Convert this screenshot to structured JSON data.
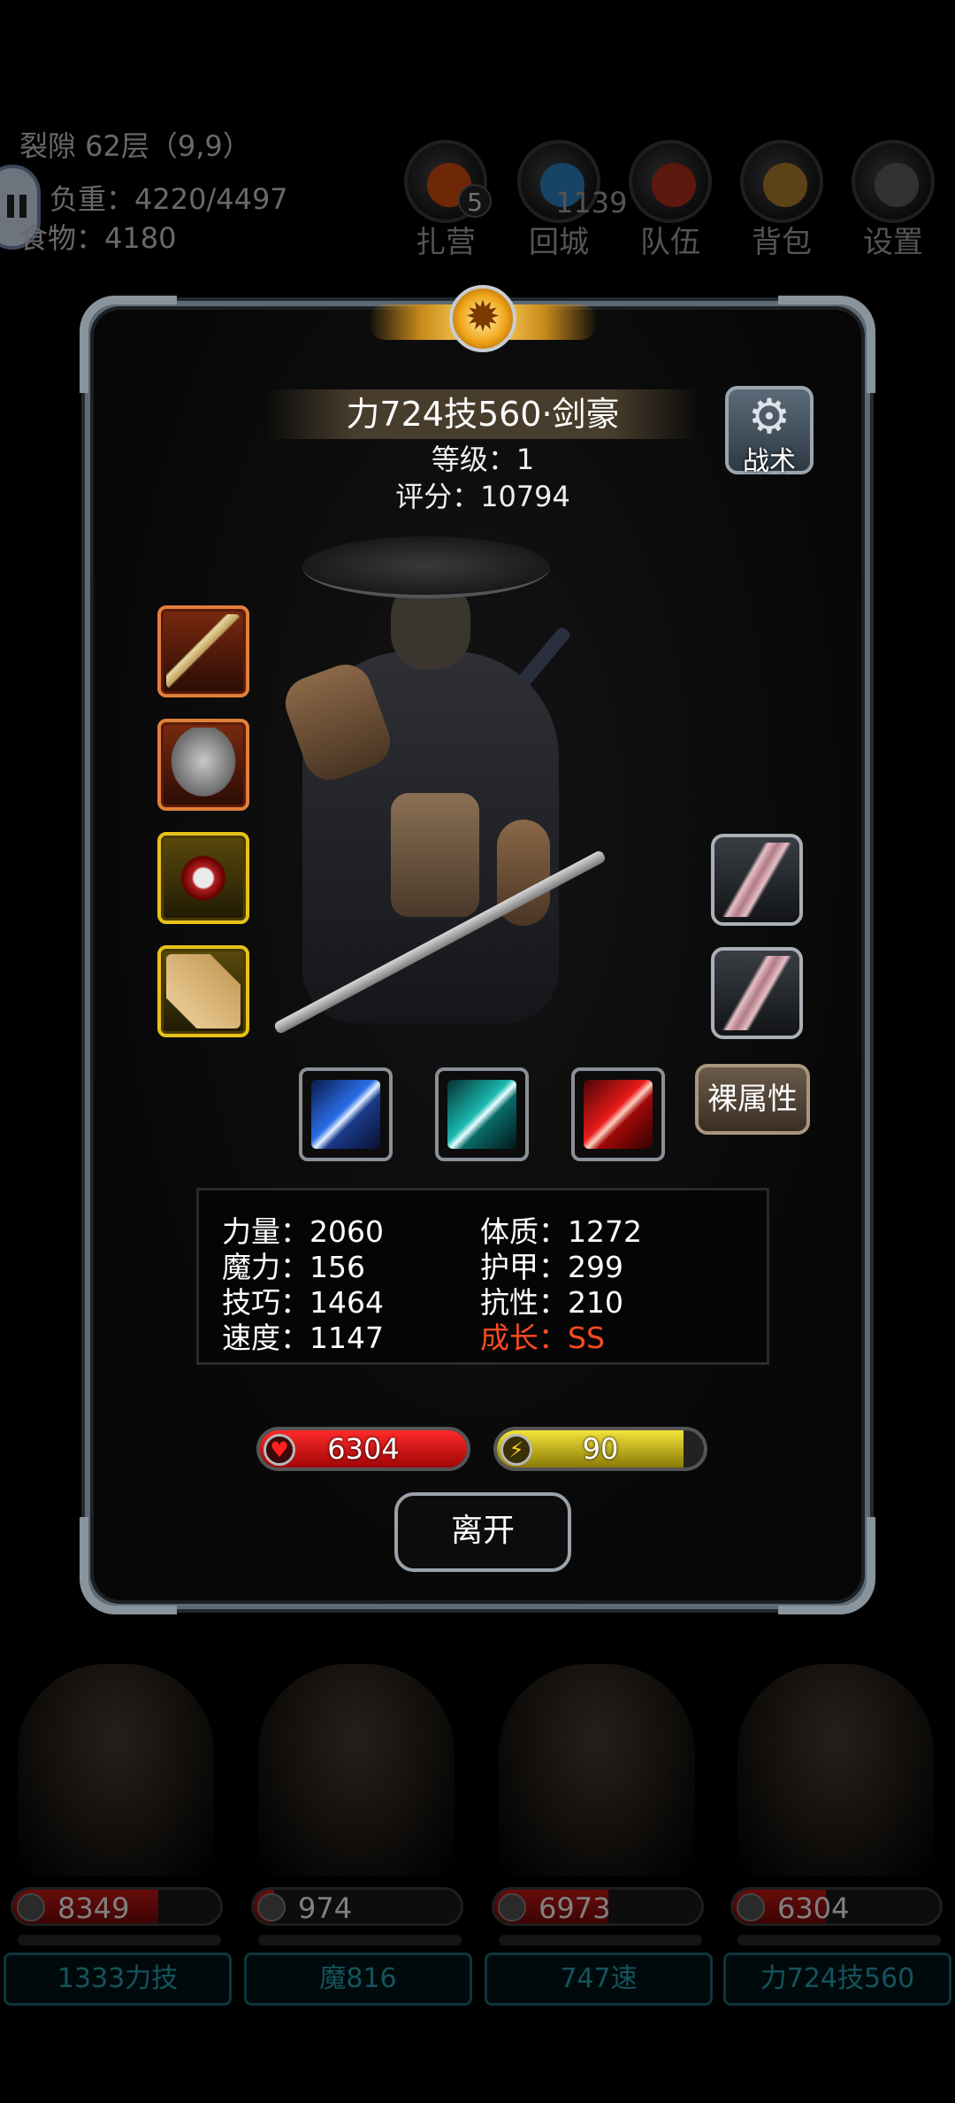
{
  "hud": {
    "location": "裂隙 62层（9,9）",
    "weight": "负重：4220/4497",
    "food": "食物：4180",
    "extra_number": "1139",
    "buttons": [
      {
        "label": "扎营",
        "badge": "5",
        "icon": "camp-icon",
        "color": "#c84a10"
      },
      {
        "label": "回城",
        "icon": "portal-icon",
        "color": "#2a7ab8"
      },
      {
        "label": "队伍",
        "icon": "team-icon",
        "color": "#a82a1a"
      },
      {
        "label": "背包",
        "icon": "backpack-icon",
        "color": "#a87a2a"
      },
      {
        "label": "设置",
        "icon": "gear-icon",
        "color": "#5a5a5a"
      }
    ]
  },
  "dialog": {
    "title": "力724技560·剑豪",
    "level": "等级：1",
    "score": "评分：10794",
    "tactics_label": "战术",
    "bare_stats_label": "裸属性",
    "leave_label": "离开",
    "equipment_left": [
      {
        "icon": "dagger-icon",
        "rarity": "red"
      },
      {
        "icon": "armor-icon",
        "rarity": "red"
      },
      {
        "icon": "ring-icon",
        "rarity": "gold"
      },
      {
        "icon": "scroll-icon",
        "rarity": "gold"
      }
    ],
    "equipment_right": [
      {
        "icon": "feather-icon",
        "rarity": "grey"
      },
      {
        "icon": "feather-icon",
        "rarity": "grey"
      }
    ],
    "skills": [
      {
        "icon": "blue-slash-icon",
        "color": "#2a6ee8"
      },
      {
        "icon": "teal-slash-icon",
        "color": "#1ab8b0"
      },
      {
        "icon": "red-slash-icon",
        "color": "#e81a1a"
      }
    ],
    "stats": {
      "strength": "力量：2060",
      "constitution": "体质：1272",
      "magic": "魔力：156",
      "armor": "护甲：299",
      "skill": "技巧：1464",
      "resistance": "抗性：210",
      "speed": "速度：1147",
      "growth": "成长：SS"
    },
    "hp": {
      "value": "6304",
      "fill": 1.0
    },
    "energy": {
      "value": "90",
      "fill": 0.9
    }
  },
  "team": [
    {
      "hp": "8349",
      "hp_fill": 0.7,
      "name": "1333力技"
    },
    {
      "hp": "974",
      "hp_fill": 0.1,
      "name": "魔816"
    },
    {
      "hp": "6973",
      "hp_fill": 0.55,
      "name": "747速"
    },
    {
      "hp": "6304",
      "hp_fill": 0.45,
      "name": "力724技560"
    }
  ],
  "colors": {
    "growth": "#ff4a22",
    "hp": "#e81a1a",
    "energy": "#f4e43a",
    "team_name": "#2aa6b8"
  }
}
